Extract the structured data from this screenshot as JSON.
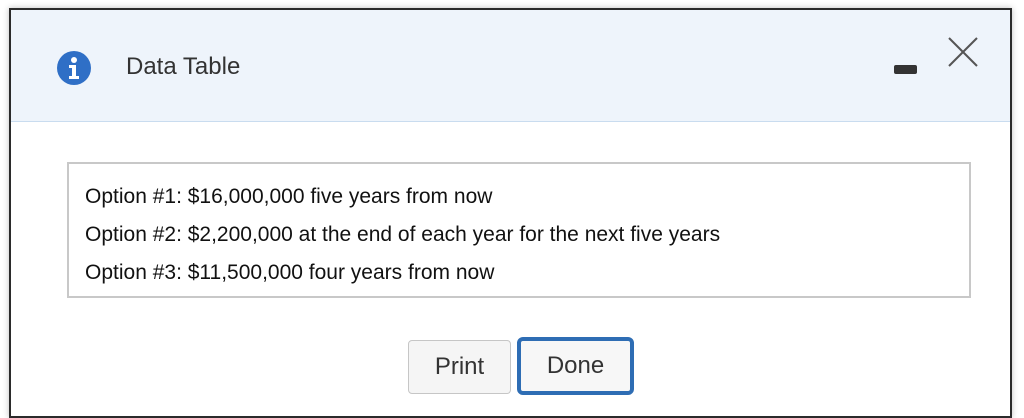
{
  "dialog": {
    "title": "Data Table",
    "icons": {
      "info": "info-icon",
      "minimize": "minimize-icon",
      "close": "close-icon"
    },
    "colors": {
      "header_bg": "#eef4fb",
      "info_blue": "#2f6fc6",
      "done_border": "#2e6db4"
    }
  },
  "content": {
    "options": [
      "Option #1:  $16,000,000 five years from now",
      "Option #2:  $2,200,000 at the end of each year for the next five years",
      "Option #3:  $11,500,000 four years from now"
    ]
  },
  "buttons": {
    "print_label": "Print",
    "done_label": "Done"
  }
}
